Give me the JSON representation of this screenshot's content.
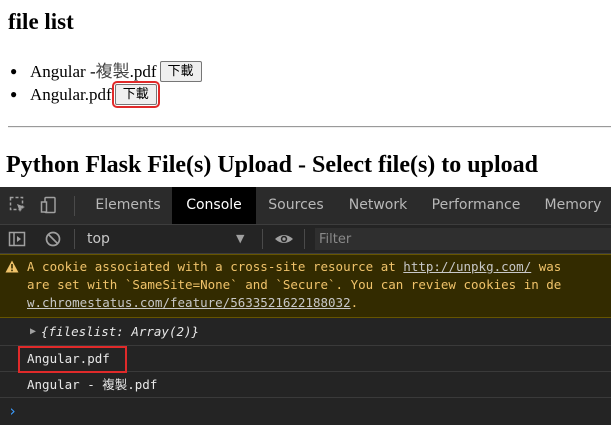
{
  "page": {
    "title": "file list",
    "files": [
      {
        "name_latin": "Angular - ",
        "name_cjk": "複製",
        "name_ext": ".pdf",
        "button": "下載"
      },
      {
        "name_latin": "Angular.pdf",
        "name_cjk": "",
        "name_ext": "",
        "button": "下載"
      }
    ],
    "upload_heading": "Python Flask File(s) Upload - Select file(s) to upload"
  },
  "devtools": {
    "tabs": [
      "Elements",
      "Console",
      "Sources",
      "Network",
      "Performance",
      "Memory"
    ],
    "active_tab": "Console",
    "icons": [
      "inspect-icon",
      "device-toggle-icon",
      "sidebar-icon",
      "clear-console-icon",
      "eye-icon"
    ],
    "context": "top",
    "filter_placeholder": "Filter",
    "warning": {
      "line1_text": "A cookie associated with a cross-site resource at ",
      "line1_link": "http://unpkg.com/",
      "line1_tail": " was",
      "line2": "are set with `SameSite=None` and `Secure`. You can review cookies in de",
      "line3_link": "w.chromestatus.com/feature/5633521622188032",
      "line3_tail": "."
    },
    "console_object": {
      "key": "fileslist",
      "value": "Array(2)"
    },
    "logs": [
      "Angular.pdf",
      "Angular - 複製.pdf"
    ],
    "colors": {
      "warning_bg": "#332b00",
      "warning_text": "#f0c36a",
      "highlight": "#e02a2a",
      "prompt": "#3c9dff"
    }
  }
}
